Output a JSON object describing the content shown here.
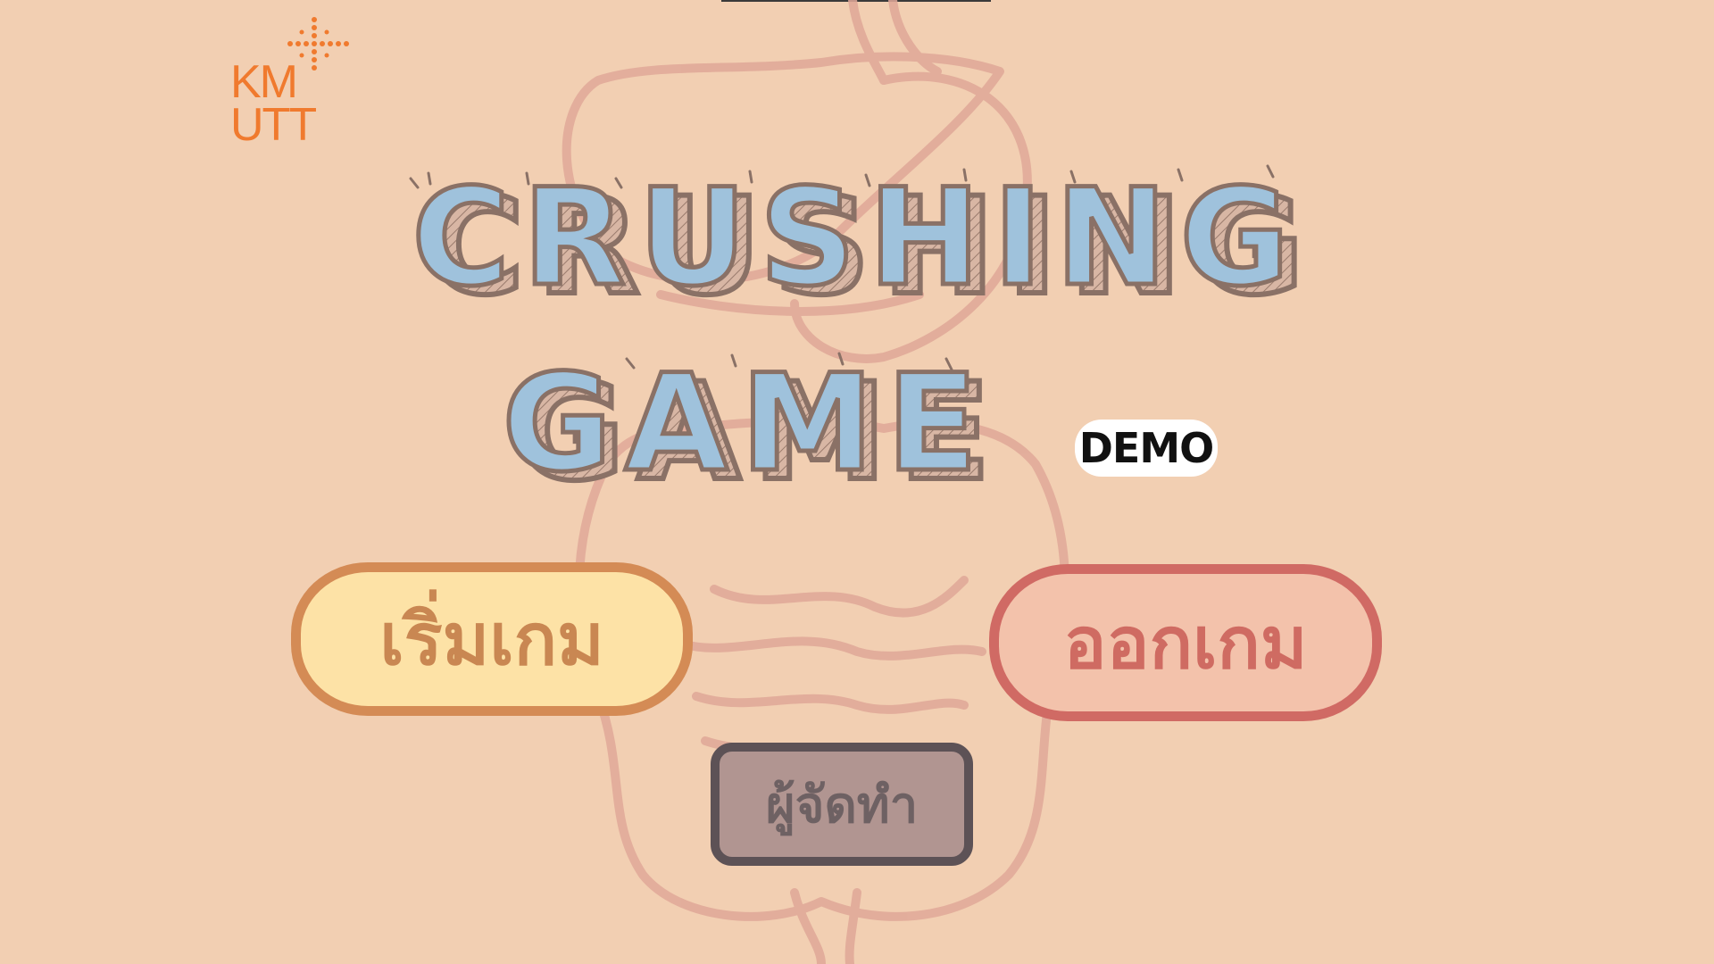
{
  "background_color": "#f2cfb2",
  "logo": {
    "line1": "KM",
    "line2": "UTT",
    "color": "#f07a2e"
  },
  "title": {
    "line1": "CRUSHING",
    "line2": "GAME",
    "fill_color": "#9fc2dc",
    "outline_color": "#8a7166",
    "shade_color": "#c9a898"
  },
  "badge": {
    "label": "DEMO"
  },
  "buttons": {
    "start": {
      "label": "เริ่มเกม",
      "fill": "#fde2a6",
      "border": "#d48b55",
      "text_color": "#c98752"
    },
    "exit": {
      "label": "ออกเกม",
      "fill": "#f3c2ab",
      "border": "#d06a64",
      "text_color": "#cf6b62"
    },
    "credits": {
      "label": "ผู้จัดทำ",
      "fill": "#b19591",
      "border": "#5d5256",
      "text_color": "#6e6163"
    }
  },
  "background_art": {
    "icon": "digestive-system-illustration",
    "line_color": "#e0a898"
  }
}
